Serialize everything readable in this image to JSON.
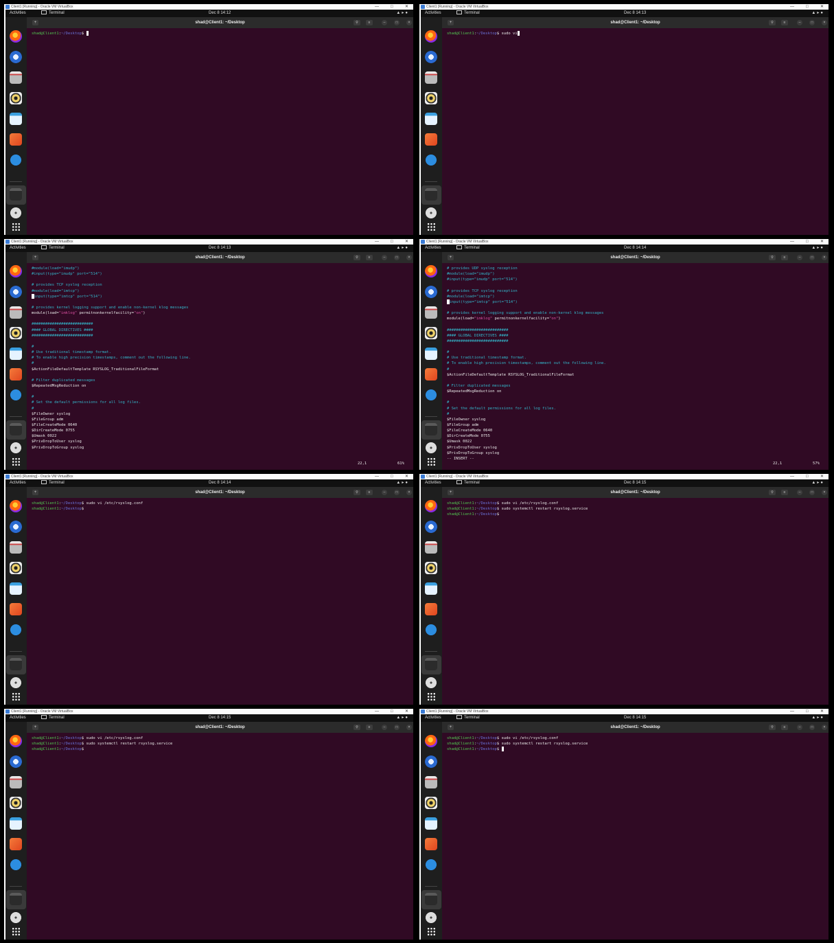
{
  "colors": {
    "terminal_bg": "#300a24",
    "prompt_user": "#52c752",
    "prompt_path": "#6a72d8",
    "comment": "#33b5c9",
    "string": "#d94fa0"
  },
  "panels": [
    {
      "vbox_title": "Client1 [Running] - Oracle VM VirtualBox",
      "activities": "Activities",
      "app_name": "Terminal",
      "clock": "Dec 8  14:12",
      "terminal_title": "shad@Client1: ~/Desktop",
      "lines": [
        [
          {
            "c": "pr-u",
            "t": "shad@Client1"
          },
          {
            "c": "",
            "t": ":"
          },
          {
            "c": "pr-p",
            "t": "~/Desktop"
          },
          {
            "c": "",
            "t": "$ "
          },
          {
            "c": "cur",
            "t": ""
          }
        ]
      ]
    },
    {
      "vbox_title": "Client1 [Running] - Oracle VM VirtualBox",
      "activities": "Activities",
      "app_name": "Terminal",
      "clock": "Dec 8  14:13",
      "terminal_title": "shad@Client1: ~/Desktop",
      "lines": [
        [
          {
            "c": "pr-u",
            "t": "shad@Client1"
          },
          {
            "c": "",
            "t": ":"
          },
          {
            "c": "pr-p",
            "t": "~/Desktop"
          },
          {
            "c": "",
            "t": "$ sudo vi"
          },
          {
            "c": "cur",
            "t": ""
          }
        ]
      ]
    },
    {
      "vbox_title": "Client1 [Running] - Oracle VM VirtualBox",
      "activities": "Activities",
      "app_name": "Terminal",
      "clock": "Dec 8  14:13",
      "terminal_title": "shad@Client1: ~/Desktop",
      "status_pos": "22,1",
      "status_pct": "61%",
      "lines": [
        [
          {
            "c": "cm",
            "t": "#module(load=\"imudp\")"
          }
        ],
        [
          {
            "c": "cm",
            "t": "#input(type=\"imudp\" port=\"514\")"
          }
        ],
        [],
        [
          {
            "c": "cm",
            "t": "# provides TCP syslog reception"
          }
        ],
        [
          {
            "c": "cm",
            "t": "#module(load=\"imtcp\")"
          }
        ],
        [
          {
            "c": "cur",
            "t": ""
          },
          {
            "c": "cm",
            "t": "input(type=\"imtcp\" port=\"514\")"
          }
        ],
        [],
        [
          {
            "c": "cm",
            "t": "# provides kernel logging support and enable non-kernel klog messages"
          }
        ],
        [
          {
            "c": "",
            "t": "module(load="
          },
          {
            "c": "st",
            "t": "\"imklog\""
          },
          {
            "c": "",
            "t": " permitnonkernelfacility="
          },
          {
            "c": "st",
            "t": "\"on\""
          },
          {
            "c": "",
            "t": ")"
          }
        ],
        [],
        [
          {
            "c": "cm",
            "t": "###########################"
          }
        ],
        [
          {
            "c": "cm",
            "t": "#### GLOBAL DIRECTIVES ####"
          }
        ],
        [
          {
            "c": "cm",
            "t": "###########################"
          }
        ],
        [],
        [
          {
            "c": "cm",
            "t": "#"
          }
        ],
        [
          {
            "c": "cm",
            "t": "# Use traditional timestamp format."
          }
        ],
        [
          {
            "c": "cm",
            "t": "# To enable high precision timestamps, comment out the following line."
          }
        ],
        [
          {
            "c": "cm",
            "t": "#"
          }
        ],
        [
          {
            "c": "",
            "t": "$ActionFileDefaultTemplate RSYSLOG_TraditionalFileFormat"
          }
        ],
        [],
        [
          {
            "c": "cm",
            "t": "# Filter duplicated messages"
          }
        ],
        [
          {
            "c": "",
            "t": "$RepeatedMsgReduction on"
          }
        ],
        [],
        [
          {
            "c": "cm",
            "t": "#"
          }
        ],
        [
          {
            "c": "cm",
            "t": "# Set the default permissions for all log files."
          }
        ],
        [
          {
            "c": "cm",
            "t": "#"
          }
        ],
        [
          {
            "c": "",
            "t": "$FileOwner syslog"
          }
        ],
        [
          {
            "c": "",
            "t": "$FileGroup adm"
          }
        ],
        [
          {
            "c": "",
            "t": "$FileCreateMode 0640"
          }
        ],
        [
          {
            "c": "",
            "t": "$DirCreateMode 0755"
          }
        ],
        [
          {
            "c": "",
            "t": "$Umask 0022"
          }
        ],
        [
          {
            "c": "",
            "t": "$PrivDropToUser syslog"
          }
        ],
        [
          {
            "c": "",
            "t": "$PrivDropToGroup syslog"
          }
        ]
      ]
    },
    {
      "vbox_title": "Client1 [Running] - Oracle VM VirtualBox",
      "activities": "Activities",
      "app_name": "Terminal",
      "clock": "Dec 8  14:14",
      "terminal_title": "shad@Client1: ~/Desktop",
      "status_pos": "22,1",
      "status_pct": "57%",
      "lines": [
        [
          {
            "c": "cm",
            "t": "# provides UDP syslog reception"
          }
        ],
        [
          {
            "c": "cm",
            "t": "#module(load=\"imudp\")"
          }
        ],
        [
          {
            "c": "cm",
            "t": "#input(type=\"imudp\" port=\"514\")"
          }
        ],
        [],
        [
          {
            "c": "cm",
            "t": "# provides TCP syslog reception"
          }
        ],
        [
          {
            "c": "cm",
            "t": "#module(load=\"imtcp\")"
          }
        ],
        [
          {
            "c": "cur",
            "t": ""
          },
          {
            "c": "cm",
            "t": "input(type=\"imtcp\" port=\"514\")"
          }
        ],
        [],
        [
          {
            "c": "cm",
            "t": "# provides kernel logging support and enable non-kernel klog messages"
          }
        ],
        [
          {
            "c": "",
            "t": "module(load="
          },
          {
            "c": "st",
            "t": "\"imklog\""
          },
          {
            "c": "",
            "t": " permitnonkernelfacility="
          },
          {
            "c": "st",
            "t": "\"on\""
          },
          {
            "c": "",
            "t": ")"
          }
        ],
        [],
        [
          {
            "c": "cm",
            "t": "###########################"
          }
        ],
        [
          {
            "c": "cm",
            "t": "#### GLOBAL DIRECTIVES ####"
          }
        ],
        [
          {
            "c": "cm",
            "t": "###########################"
          }
        ],
        [],
        [
          {
            "c": "cm",
            "t": "#"
          }
        ],
        [
          {
            "c": "cm",
            "t": "# Use traditional timestamp format."
          }
        ],
        [
          {
            "c": "cm",
            "t": "# To enable high precision timestamps, comment out the following line."
          }
        ],
        [
          {
            "c": "cm",
            "t": "#"
          }
        ],
        [
          {
            "c": "",
            "t": "$ActionFileDefaultTemplate RSYSLOG_TraditionalFileFormat"
          }
        ],
        [],
        [
          {
            "c": "cm",
            "t": "# Filter duplicated messages"
          }
        ],
        [
          {
            "c": "",
            "t": "$RepeatedMsgReduction on"
          }
        ],
        [],
        [
          {
            "c": "cm",
            "t": "#"
          }
        ],
        [
          {
            "c": "cm",
            "t": "# Set the default permissions for all log files."
          }
        ],
        [
          {
            "c": "cm",
            "t": "#"
          }
        ],
        [
          {
            "c": "",
            "t": "$FileOwner syslog"
          }
        ],
        [
          {
            "c": "",
            "t": "$FileGroup adm"
          }
        ],
        [
          {
            "c": "",
            "t": "$FileCreateMode 0640"
          }
        ],
        [
          {
            "c": "",
            "t": "$DirCreateMode 0755"
          }
        ],
        [
          {
            "c": "",
            "t": "$Umask 0022"
          }
        ],
        [
          {
            "c": "",
            "t": "$PrivDropToUser syslog"
          }
        ],
        [
          {
            "c": "",
            "t": "$PrivDropToGroup syslog"
          }
        ],
        [
          {
            "c": "",
            "t": "-- INSERT --"
          }
        ]
      ]
    },
    {
      "vbox_title": "Client1 [Running] - Oracle VM VirtualBox",
      "activities": "Activities",
      "app_name": "Terminal",
      "clock": "Dec 8  14:14",
      "terminal_title": "shad@Client1: ~/Desktop",
      "lines": [
        [
          {
            "c": "pr-u",
            "t": "shad@Client1"
          },
          {
            "c": "",
            "t": ":"
          },
          {
            "c": "pr-p",
            "t": "~/Desktop"
          },
          {
            "c": "",
            "t": "$ sudo vi /etc/rsyslog.conf"
          }
        ],
        [
          {
            "c": "pr-u",
            "t": "shad@Client1"
          },
          {
            "c": "",
            "t": ":"
          },
          {
            "c": "pr-p",
            "t": "~/Desktop"
          },
          {
            "c": "",
            "t": "$ "
          }
        ]
      ]
    },
    {
      "vbox_title": "Client1 [Running] - Oracle VM VirtualBox",
      "activities": "Activities",
      "app_name": "Terminal",
      "clock": "Dec 8  14:15",
      "terminal_title": "shad@Client1: ~/Desktop",
      "lines": [
        [
          {
            "c": "pr-u",
            "t": "shad@Client1"
          },
          {
            "c": "",
            "t": ":"
          },
          {
            "c": "pr-p",
            "t": "~/Desktop"
          },
          {
            "c": "",
            "t": "$ sudo vi /etc/rsyslog.conf"
          }
        ],
        [
          {
            "c": "pr-u",
            "t": "shad@Client1"
          },
          {
            "c": "",
            "t": ":"
          },
          {
            "c": "pr-p",
            "t": "~/Desktop"
          },
          {
            "c": "",
            "t": "$ sudo systemctl restart rsyslog.service"
          }
        ],
        [
          {
            "c": "pr-u",
            "t": "shad@Client1"
          },
          {
            "c": "",
            "t": ":"
          },
          {
            "c": "pr-p",
            "t": "~/Desktop"
          },
          {
            "c": "",
            "t": "$ "
          }
        ]
      ]
    },
    {
      "vbox_title": "Client1 [Running] - Oracle VM VirtualBox",
      "activities": "Activities",
      "app_name": "Terminal",
      "clock": "Dec 8  14:15",
      "terminal_title": "shad@Client1: ~/Desktop",
      "lines": [
        [
          {
            "c": "pr-u",
            "t": "shad@Client1"
          },
          {
            "c": "",
            "t": ":"
          },
          {
            "c": "pr-p",
            "t": "~/Desktop"
          },
          {
            "c": "",
            "t": "$ sudo vi /etc/rsyslog.conf"
          }
        ],
        [
          {
            "c": "pr-u",
            "t": "shad@Client1"
          },
          {
            "c": "",
            "t": ":"
          },
          {
            "c": "pr-p",
            "t": "~/Desktop"
          },
          {
            "c": "",
            "t": "$ sudo systemctl restart rsyslog.service"
          }
        ],
        [
          {
            "c": "pr-u",
            "t": "shad@Client1"
          },
          {
            "c": "",
            "t": ":"
          },
          {
            "c": "pr-p",
            "t": "~/Desktop"
          },
          {
            "c": "",
            "t": "$ "
          }
        ]
      ]
    },
    {
      "vbox_title": "Client1 [Running] - Oracle VM VirtualBox",
      "activities": "Activities",
      "app_name": "Terminal",
      "clock": "Dec 8  14:15",
      "terminal_title": "shad@Client1: ~/Desktop",
      "lines": [
        [
          {
            "c": "pr-u",
            "t": "shad@Client1"
          },
          {
            "c": "",
            "t": ":"
          },
          {
            "c": "pr-p",
            "t": "~/Desktop"
          },
          {
            "c": "",
            "t": "$ sudo vi /etc/rsyslog.conf"
          }
        ],
        [
          {
            "c": "pr-u",
            "t": "shad@Client1"
          },
          {
            "c": "",
            "t": ":"
          },
          {
            "c": "pr-p",
            "t": "~/Desktop"
          },
          {
            "c": "",
            "t": "$ sudo systemctl restart rsyslog.service"
          }
        ],
        [
          {
            "c": "pr-u",
            "t": "shad@Client1"
          },
          {
            "c": "",
            "t": ":"
          },
          {
            "c": "pr-p",
            "t": "~/Desktop"
          },
          {
            "c": "",
            "t": "$ "
          },
          {
            "c": "cur",
            "t": ""
          }
        ]
      ]
    }
  ],
  "dock_icons": [
    "firefox-icon",
    "thunderbird-icon",
    "files-icon",
    "rhythmbox-icon",
    "writer-icon",
    "app-center-icon",
    "help-icon",
    "terminal-icon",
    "disc-icon",
    "app-grid-icon"
  ]
}
